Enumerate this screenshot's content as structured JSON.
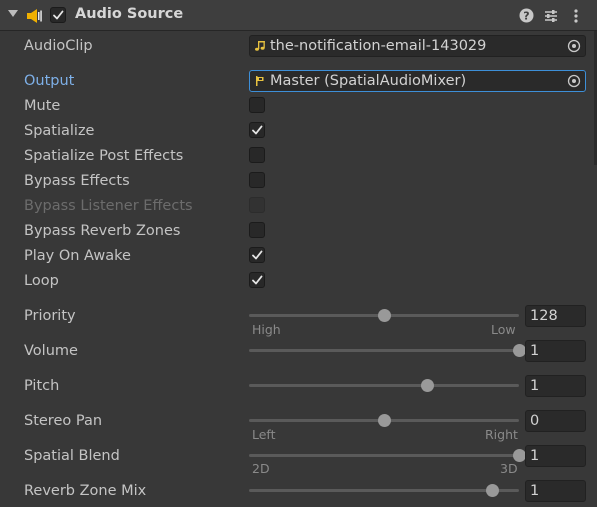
{
  "header": {
    "title": "Audio Source",
    "enabled": true,
    "icons": [
      "foldout-arrow-icon",
      "speaker-icon",
      "help-icon",
      "preset-icon",
      "menu-icon"
    ]
  },
  "properties": {
    "audio_clip": {
      "label": "AudioClip",
      "value": "the-notification-email-143029",
      "icon": "music-note-icon"
    },
    "output": {
      "label": "Output",
      "value": "Master (SpatialAudioMixer)",
      "icon": "mixer-group-icon"
    },
    "mute": {
      "label": "Mute",
      "checked": false
    },
    "spatialize": {
      "label": "Spatialize",
      "checked": true
    },
    "spatialize_post_effects": {
      "label": "Spatialize Post Effects",
      "checked": false
    },
    "bypass_effects": {
      "label": "Bypass Effects",
      "checked": false
    },
    "bypass_listener_effects": {
      "label": "Bypass Listener Effects",
      "checked": false,
      "disabled": true
    },
    "bypass_reverb_zones": {
      "label": "Bypass Reverb Zones",
      "checked": false
    },
    "play_on_awake": {
      "label": "Play On Awake",
      "checked": true
    },
    "loop": {
      "label": "Loop",
      "checked": true
    }
  },
  "sliders": {
    "priority": {
      "label": "Priority",
      "value": "128",
      "min_label": "High",
      "max_label": "Low",
      "fraction": 0.5
    },
    "volume": {
      "label": "Volume",
      "value": "1",
      "fraction": 1.0
    },
    "pitch": {
      "label": "Pitch",
      "value": "1",
      "fraction": 0.66
    },
    "stereo_pan": {
      "label": "Stereo Pan",
      "value": "0",
      "min_label": "Left",
      "max_label": "Right",
      "fraction": 0.5
    },
    "spatial_blend": {
      "label": "Spatial Blend",
      "value": "1",
      "min_label": "2D",
      "max_label": "3D",
      "fraction": 1.0
    },
    "reverb_zone_mix": {
      "label": "Reverb Zone Mix",
      "value": "1",
      "fraction": 0.9
    }
  },
  "colors": {
    "background": "#383838",
    "header": "#3e3e3e",
    "highlight_label": "#7eb0e8",
    "focus_border": "#3d8fd8",
    "speaker_icon": "#f0b000"
  }
}
